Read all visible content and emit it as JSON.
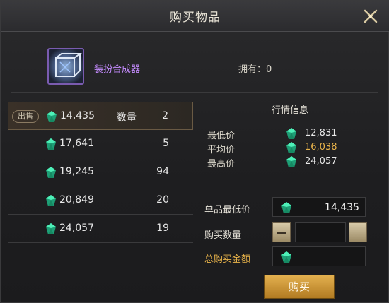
{
  "window": {
    "title": "购买物品"
  },
  "item": {
    "name": "装扮合成器",
    "owned_label": "拥有：0"
  },
  "listings": [
    {
      "badge": "出售",
      "price": "14,435",
      "qty_label": "数量",
      "qty": "2"
    },
    {
      "price": "17,641",
      "qty": "5"
    },
    {
      "price": "19,245",
      "qty": "94"
    },
    {
      "price": "20,849",
      "qty": "20"
    },
    {
      "price": "24,057",
      "qty": "19"
    }
  ],
  "market": {
    "title": "行情信息",
    "min_label": "最低价",
    "min_value": "12,831",
    "avg_label": "平均价",
    "avg_value": "16,038",
    "max_label": "最高价",
    "max_value": "24,057"
  },
  "form": {
    "unit_price_label": "单品最低价",
    "unit_price_value": "14,435",
    "qty_label": "购买数量",
    "total_label": "总购买金额",
    "buy_label": "购买"
  },
  "colors": {
    "accent_gold": "#e8b34a",
    "item_purple": "#c58cff",
    "gem_green": "#2fd39a"
  }
}
